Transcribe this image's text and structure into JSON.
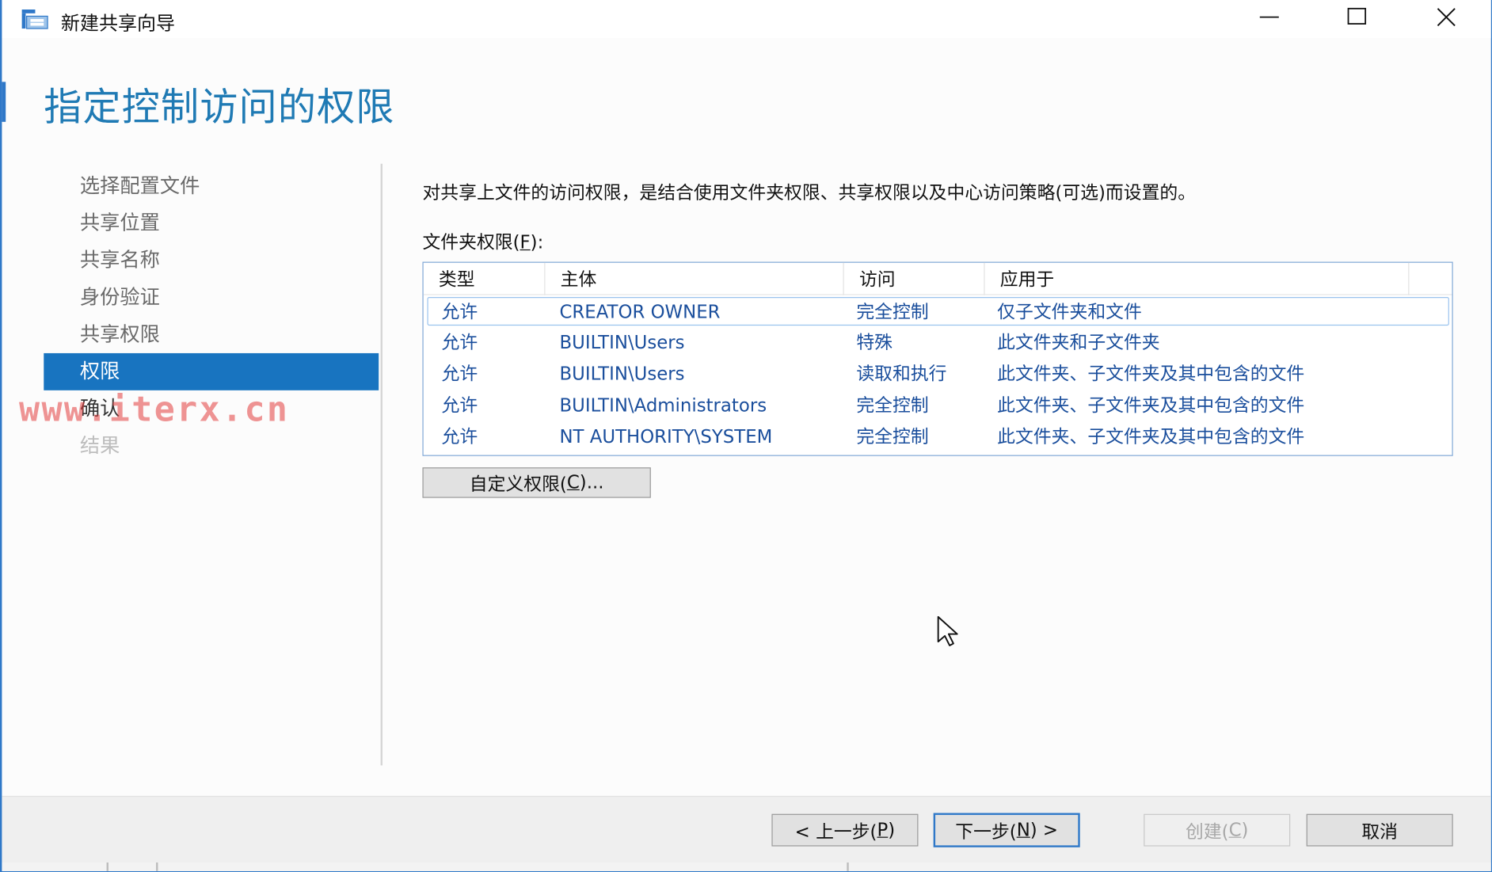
{
  "window": {
    "title": "新建共享向导",
    "controls": {
      "minimize": "minimize-icon",
      "maximize": "maximize-icon",
      "close": "close-icon"
    }
  },
  "page": {
    "heading": "指定控制访问的权限"
  },
  "nav": {
    "items": [
      {
        "label": "选择配置文件"
      },
      {
        "label": "共享位置"
      },
      {
        "label": "共享名称"
      },
      {
        "label": "身份验证"
      },
      {
        "label": "共享权限"
      },
      {
        "label": "权限"
      },
      {
        "label": "确认"
      },
      {
        "label": "结果"
      }
    ]
  },
  "content": {
    "description": "对共享上文件的访问权限，是结合使用文件夹权限、共享权限以及中心访问策略(可选)而设置的。",
    "folder_permissions_label_prefix": "文件夹权限(",
    "folder_permissions_label_key": "F",
    "folder_permissions_label_suffix": "):",
    "table": {
      "headers": [
        "类型",
        "主体",
        "访问",
        "应用于"
      ],
      "rows": [
        {
          "type": "允许",
          "principal": "CREATOR OWNER",
          "access": "完全控制",
          "applies_to": "仅子文件夹和文件"
        },
        {
          "type": "允许",
          "principal": "BUILTIN\\Users",
          "access": "特殊",
          "applies_to": "此文件夹和子文件夹"
        },
        {
          "type": "允许",
          "principal": "BUILTIN\\Users",
          "access": "读取和执行",
          "applies_to": "此文件夹、子文件夹及其中包含的文件"
        },
        {
          "type": "允许",
          "principal": "BUILTIN\\Administrators",
          "access": "完全控制",
          "applies_to": "此文件夹、子文件夹及其中包含的文件"
        },
        {
          "type": "允许",
          "principal": "NT AUTHORITY\\SYSTEM",
          "access": "完全控制",
          "applies_to": "此文件夹、子文件夹及其中包含的文件"
        }
      ]
    },
    "custom_button": {
      "prefix": "自定义权限(",
      "key": "C",
      "suffix": ")..."
    }
  },
  "footer": {
    "back": {
      "prefix": "< 上一步(",
      "key": "P",
      "suffix": ")"
    },
    "next": {
      "prefix": "下一步(",
      "key": "N",
      "suffix": ") >"
    },
    "create": {
      "prefix": "创建(",
      "key": "C",
      "suffix": ")"
    },
    "cancel": "取消"
  },
  "watermark": "www.iterx.cn",
  "colors": {
    "accent": "#1874c0",
    "heading": "#1f7ab4",
    "table_text": "#1a4e9c"
  }
}
